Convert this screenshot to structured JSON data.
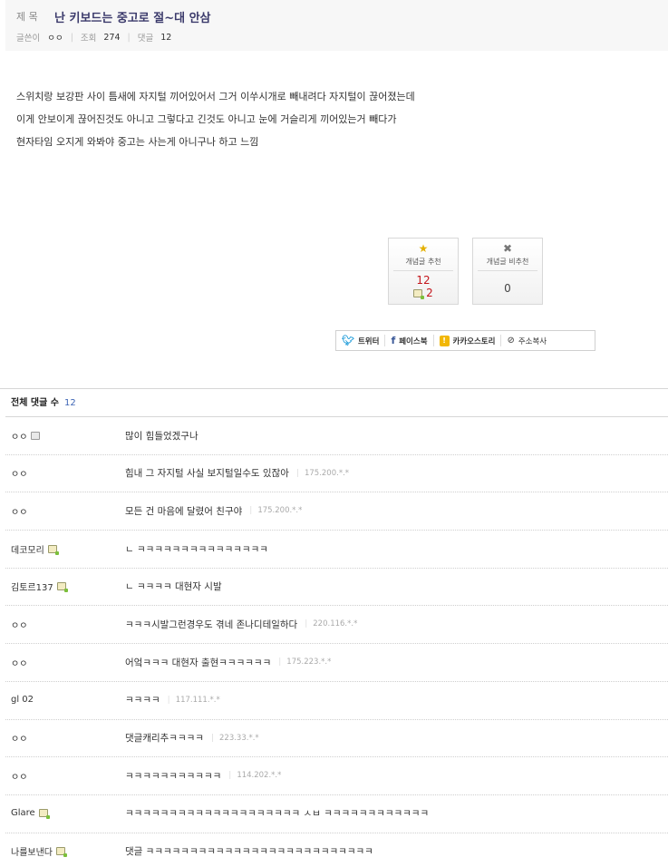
{
  "post": {
    "title_label": "제 목",
    "title": "난 키보드는 중고로 절~대 안삼",
    "author_label": "글쓴이",
    "author": "ㅇㅇ",
    "views_label": "조회",
    "views": "274",
    "comments_label": "댓글",
    "comments": "12",
    "body_lines": [
      "스위치랑 보강판 사이 틈새에 자지털 끼어있어서 그거 이쑤시개로 빼내려다 자지털이 끊어졌는데",
      "이게 안보이게 끊어진것도 아니고 그렇다고 긴것도 아니고 눈에 거슬리게 끼어있는거 빼다가",
      "현자타임 오지게 와봐야 중고는 사는게 아니구나 하고 느낌"
    ]
  },
  "vote": {
    "up_label": "개념글 추천",
    "up_count": "12",
    "up_fix_count": "2",
    "down_label": "개념글 비추천",
    "down_count": "0",
    "up_icon": "star-icon",
    "down_icon": "x-icon"
  },
  "share": {
    "twitter": "트위터",
    "facebook": "페이스북",
    "kakaostory": "카카오스토리",
    "copy_url": "주소복사"
  },
  "comments_section": {
    "title": "전체 댓글 수",
    "count": "12",
    "items": [
      {
        "nick": "ㅇㅇ",
        "text": "많이 힘들었겠구나",
        "ip": ""
      },
      {
        "nick": "ㅇㅇ",
        "text": "힘내 그 자지털 사실 보지털일수도 있잖아",
        "ip": "175.200.*.*"
      },
      {
        "nick": "ㅇㅇ",
        "text": "모든 건 마음에 달렸어 친구야",
        "ip": "175.200.*.*"
      },
      {
        "nick": "데코모리",
        "text": "ㄴ ㅋㅋㅋㅋㅋㅋㅋㅋㅋㅋㅋㅋㅋㅋㅋ",
        "ip": ""
      },
      {
        "nick": "김토르137",
        "text": "ㄴ ㅋㅋㅋㅋ 대현자 시발",
        "ip": ""
      },
      {
        "nick": "ㅇㅇ",
        "text": "ㅋㅋㅋ시발그런경우도 겪네 존나디테일하다",
        "ip": "220.116.*.*"
      },
      {
        "nick": "ㅇㅇ",
        "text": "어엌ㅋㅋㅋ 대현자 출현ㅋㅋㅋㅋㅋㅋ",
        "ip": "175.223.*.*"
      },
      {
        "nick": "gl 02",
        "text": "ㅋㅋㅋㅋ",
        "ip": "117.111.*.*"
      },
      {
        "nick": "ㅇㅇ",
        "text": "댓글캐리추ㅋㅋㅋㅋ",
        "ip": "223.33.*.*"
      },
      {
        "nick": "ㅇㅇ",
        "text": "ㅋㅋㅋㅋㅋㅋㅋㅋㅋㅋㅋ",
        "ip": "114.202.*.*"
      },
      {
        "nick": "Glare",
        "text": "ㅋㅋㅋㅋㅋㅋㅋㅋㅋㅋㅋㅋㅋㅋㅋㅋㅋㅋㅋㅋ ㅅㅂ ㅋㅋㅋㅋㅋㅋㅋㅋㅋㅋㅋㅋ",
        "ip": ""
      },
      {
        "nick": "나를보낸다",
        "text": "댓글 ㅋㅋㅋㅋㅋㅋㅋㅋㅋㅋㅋㅋㅋㅋㅋㅋㅋㅋㅋㅋㅋㅋㅋㅋㅋㅋ",
        "ip": ""
      }
    ]
  },
  "colors": {
    "title": "#3b3a6b",
    "vote_up": "#c4161c",
    "comment_count": "#3e66b5",
    "header_bg": "#f7f7f7"
  }
}
